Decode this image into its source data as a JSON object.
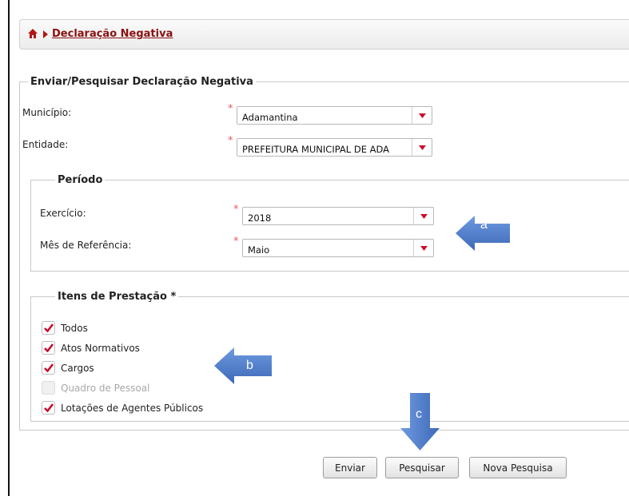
{
  "breadcrumb": {
    "home_icon": "home-icon",
    "separator_icon": "chevron-right-icon",
    "title": "Declaração Negativa"
  },
  "form": {
    "legend": "Enviar/Pesquisar Declaração Negativa",
    "municipio": {
      "label": "Município:",
      "required_mark": "*",
      "value": "Adamantina"
    },
    "entidade": {
      "label": "Entidade:",
      "required_mark": "*",
      "value": "PREFEITURA MUNICIPAL DE ADA"
    }
  },
  "periodo": {
    "legend": "Período",
    "exercicio": {
      "label": "Exercício:",
      "required_mark": "*",
      "value": "2018"
    },
    "mes": {
      "label": "Mês de Referência:",
      "required_mark": "*",
      "value": "Maio"
    }
  },
  "itens": {
    "legend": "Itens de Prestação *",
    "items": [
      {
        "label": "Todos",
        "checked": true,
        "disabled": false
      },
      {
        "label": "Atos Normativos",
        "checked": true,
        "disabled": false
      },
      {
        "label": "Cargos",
        "checked": true,
        "disabled": false
      },
      {
        "label": "Quadro de Pessoal",
        "checked": false,
        "disabled": true
      },
      {
        "label": "Lotações de Agentes Públicos",
        "checked": true,
        "disabled": false
      }
    ]
  },
  "actions": {
    "enviar": "Enviar",
    "pesquisar": "Pesquisar",
    "nova_pesquisa": "Nova Pesquisa"
  },
  "annotations": {
    "a": "a",
    "b": "b",
    "c": "c"
  },
  "colors": {
    "accent": "#8a1010",
    "required": "#e06060",
    "check": "#c8102e",
    "callout_arrow": "#4a78c8"
  }
}
